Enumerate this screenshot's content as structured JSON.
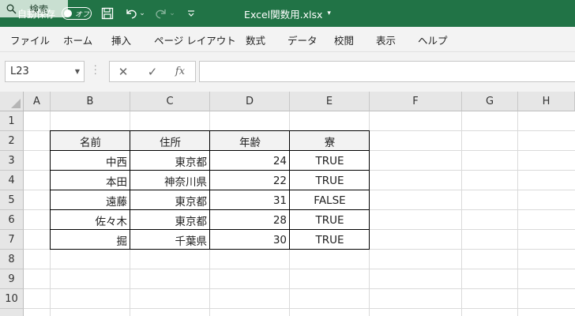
{
  "titlebar": {
    "autosave_label": "自動保存",
    "autosave_state": "オフ",
    "filename": "Excel関数用.xlsx",
    "search_label": "検索",
    "bg_color": "#217346"
  },
  "ribbon": {
    "tabs": [
      "ファイル",
      "ホーム",
      "挿入",
      "ページ レイアウト",
      "数式",
      "データ",
      "校閲",
      "表示",
      "ヘルプ"
    ]
  },
  "formula_bar": {
    "name_box": "L23",
    "formula": ""
  },
  "sheet": {
    "columns": [
      "A",
      "B",
      "C",
      "D",
      "E",
      "F",
      "G",
      "H"
    ],
    "rows": [
      "1",
      "2",
      "3",
      "4",
      "5",
      "6",
      "7",
      "8",
      "9",
      "10"
    ],
    "table": {
      "headers": [
        "名前",
        "住所",
        "年齢",
        "寮"
      ],
      "rows": [
        [
          "中西",
          "東京都",
          "24",
          "TRUE"
        ],
        [
          "本田",
          "神奈川県",
          "22",
          "TRUE"
        ],
        [
          "遠藤",
          "東京都",
          "31",
          "FALSE"
        ],
        [
          "佐々木",
          "東京都",
          "28",
          "TRUE"
        ],
        [
          "掘",
          "千葉県",
          "30",
          "TRUE"
        ]
      ]
    }
  }
}
